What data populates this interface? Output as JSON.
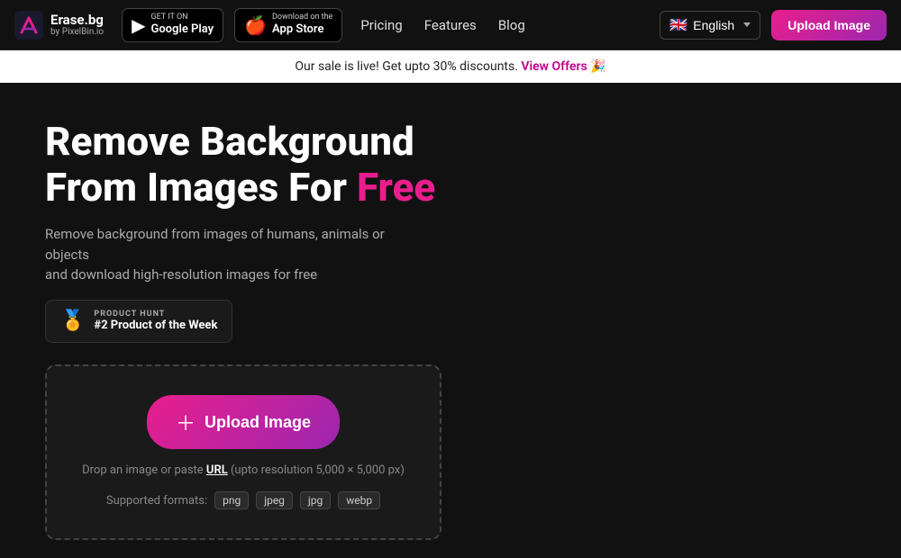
{
  "logo": {
    "main": "Erase.bg",
    "sub": "by PixelBin.io"
  },
  "nav": {
    "google_play_label_small": "GET IT ON",
    "google_play_label_large": "Google Play",
    "app_store_label_small": "Download on the",
    "app_store_label_large": "App Store",
    "links": [
      {
        "id": "pricing",
        "label": "Pricing"
      },
      {
        "id": "features",
        "label": "Features"
      },
      {
        "id": "blog",
        "label": "Blog"
      }
    ],
    "language": "English",
    "upload_btn": "Upload Image"
  },
  "sale_banner": {
    "text": "Our sale is live! Get upto 30% discounts.",
    "cta": "View Offers 🎉"
  },
  "hero": {
    "title_line1": "Remove Background",
    "title_line2": "From Images For ",
    "title_free": "Free",
    "subtitle": "Remove background from images of humans, animals or objects\nand download high-resolution images for free"
  },
  "product_hunt": {
    "label": "PRODUCT HUNT",
    "rank": "#2 Product of the Week",
    "icon": "🏅"
  },
  "upload_area": {
    "button_label": "Upload Image",
    "hint_text": "Drop an image or paste ",
    "hint_url": "URL",
    "hint_suffix": " (upto resolution 5,000 × 5,000 px)",
    "supported_label": "Supported formats:",
    "formats": [
      "png",
      "jpeg",
      "jpg",
      "webp"
    ]
  }
}
